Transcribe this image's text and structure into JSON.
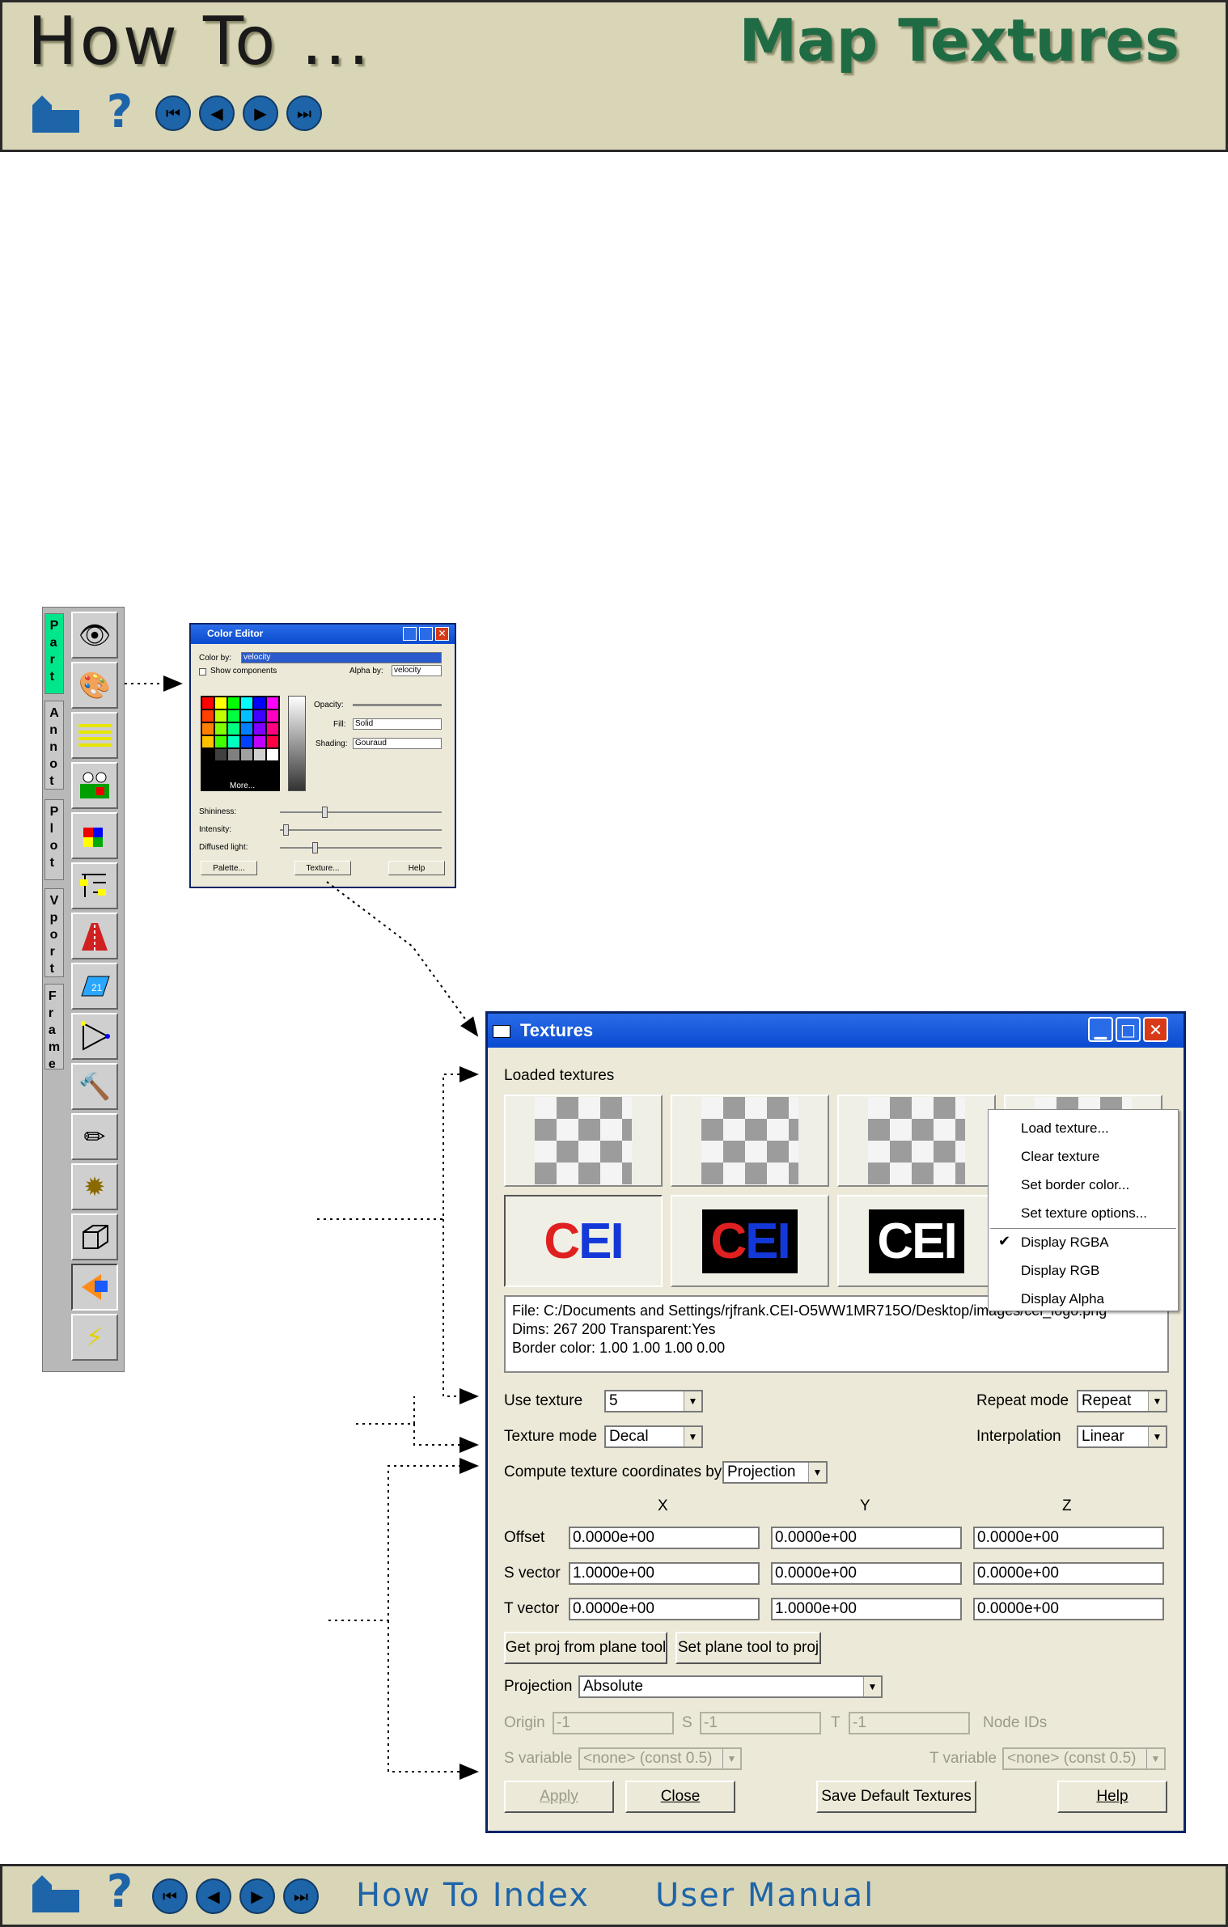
{
  "header": {
    "title_left": "How To ...",
    "title_right": "Map Textures"
  },
  "footer": {
    "how_to_index": "How To Index",
    "user_manual": "User Manual"
  },
  "toolbar": {
    "tabs": [
      "Part",
      "Annot",
      "Plot",
      "Vport",
      "Frame"
    ],
    "tools": [
      "eye-icon",
      "paint-bucket-icon",
      "lines-icon",
      "eyes-icon",
      "cube-icon",
      "tree-icon",
      "road-icon",
      "quad-icon",
      "select-icon",
      "hammer-icon",
      "pencil-icon",
      "sun-icon",
      "box-icon",
      "light-icon",
      "lightning-icon"
    ]
  },
  "color_editor": {
    "title": "Color Editor",
    "color_by_label": "Color by:",
    "color_by_value": "velocity",
    "show_components": "Show components",
    "alpha_by_label": "Alpha by:",
    "alpha_by_value": "velocity",
    "opacity_label": "Opacity:",
    "fill_label": "Fill:",
    "fill_value": "Solid",
    "shading_label": "Shading:",
    "shading_value": "Gouraud",
    "more_label": "More...",
    "shininess_label": "Shininess:",
    "intensity_label": "Intensity:",
    "diffused_label": "Diffused light:",
    "palette_button": "Palette...",
    "texture_button": "Texture...",
    "help_button": "Help",
    "swatches": [
      "#ff0000",
      "#ffff00",
      "#00ff00",
      "#00ffff",
      "#0000ff",
      "#ff00ff",
      "#ff4000",
      "#c0ff00",
      "#00ff40",
      "#00c0ff",
      "#4000ff",
      "#ff00c0",
      "#ff8000",
      "#80ff00",
      "#00ff80",
      "#0080ff",
      "#8000ff",
      "#ff0080",
      "#ffc000",
      "#40ff00",
      "#00ffc0",
      "#0040ff",
      "#c000ff",
      "#ff0040",
      "#000000",
      "#404040",
      "#808080",
      "#a0a0a0",
      "#d0d0d0",
      "#ffffff"
    ]
  },
  "textures": {
    "title": "Textures",
    "loaded_label": "Loaded textures",
    "file_info": [
      "File: C:/Documents and Settings/rjfrank.CEI-O5WW1MR715O/Desktop/images/cei_logo.png",
      "Dims: 267 200 Transparent:Yes",
      "Border color: 1.00 1.00 1.00 0.00"
    ],
    "use_texture_label": "Use texture",
    "use_texture_value": "5",
    "repeat_mode_label": "Repeat mode",
    "repeat_mode_value": "Repeat",
    "texture_mode_label": "Texture mode",
    "texture_mode_value": "Decal",
    "interpolation_label": "Interpolation",
    "interpolation_value": "Linear",
    "compute_label": "Compute texture coordinates by",
    "compute_value": "Projection",
    "col_x": "X",
    "col_y": "Y",
    "col_z": "Z",
    "rows": [
      {
        "label": "Offset",
        "x": "0.0000e+00",
        "y": "0.0000e+00",
        "z": "0.0000e+00"
      },
      {
        "label": "S vector",
        "x": "1.0000e+00",
        "y": "0.0000e+00",
        "z": "0.0000e+00"
      },
      {
        "label": "T vector",
        "x": "0.0000e+00",
        "y": "1.0000e+00",
        "z": "0.0000e+00"
      }
    ],
    "get_proj_button": "Get proj from plane tool",
    "set_plane_button": "Set plane tool to proj",
    "projection_label": "Projection",
    "projection_value": "Absolute",
    "origin_label": "Origin",
    "origin_value": "-1",
    "s_label": "S",
    "s_value": "-1",
    "t_label": "T",
    "t_value": "-1",
    "node_ids_label": "Node IDs",
    "s_variable_label": "S variable",
    "s_variable_value": "<none> (const 0.5)",
    "t_variable_label": "T variable",
    "t_variable_value": "<none> (const 0.5)",
    "apply_button": "Apply",
    "close_button": "Close",
    "save_default_button": "Save Default Textures",
    "help_button": "Help",
    "context_menu": [
      "Load texture...",
      "Clear texture",
      "Set border color...",
      "Set texture options...",
      "Display RGBA",
      "Display RGB",
      "Display Alpha"
    ],
    "checked_item": "Display RGBA"
  }
}
